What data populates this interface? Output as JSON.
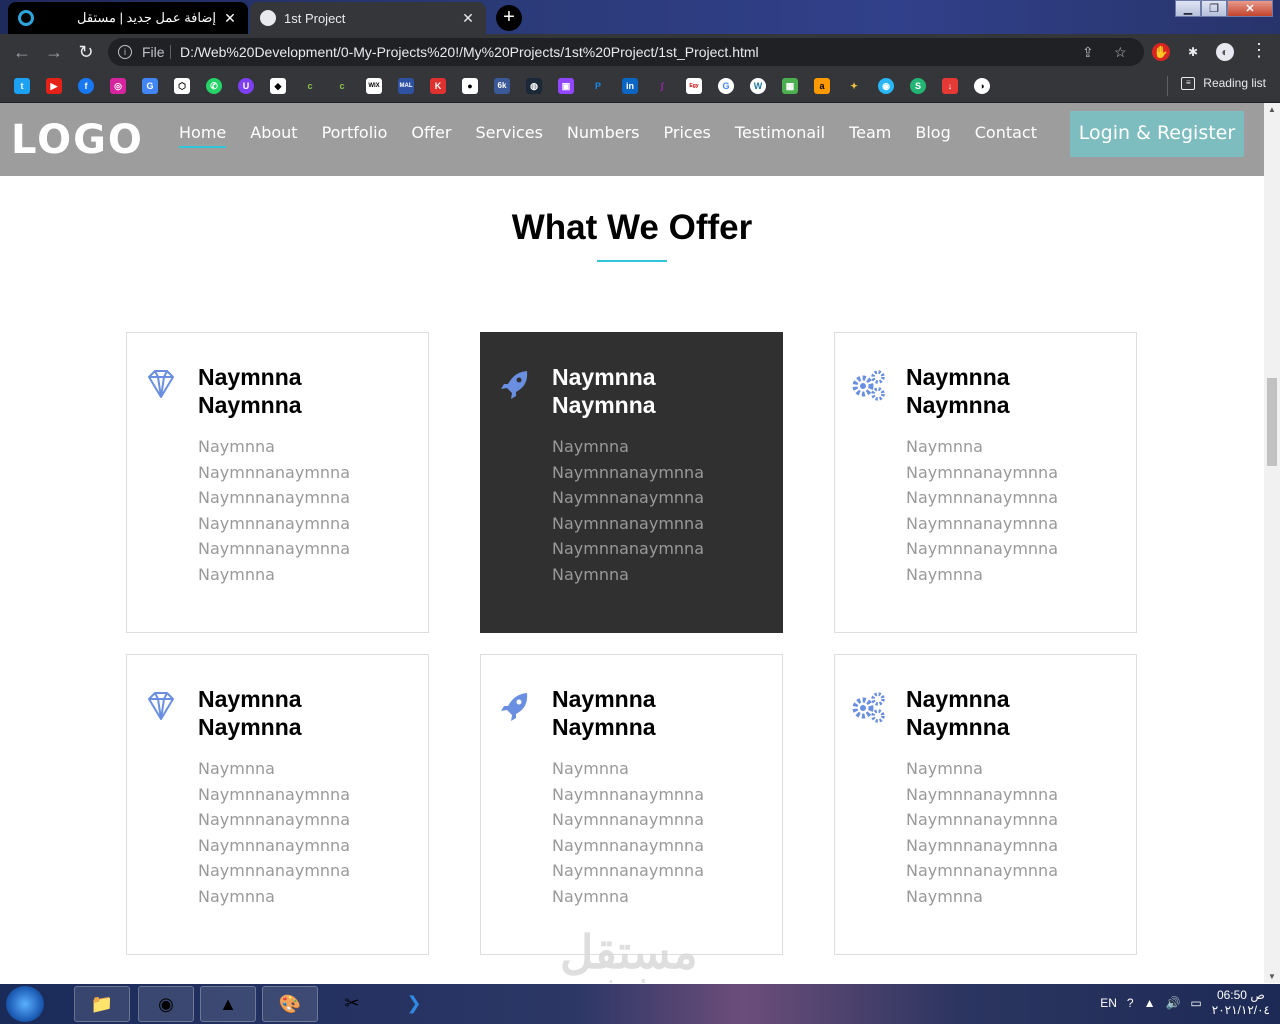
{
  "browser": {
    "tabs": [
      {
        "title": "إضافة عمل جديد | مستقل",
        "active": false
      },
      {
        "title": "1st Project",
        "active": true
      }
    ],
    "new_tab": "+",
    "url_scheme": "File",
    "url": "D:/Web%20Development/0-My-Projects%20!/My%20Projects/1st%20Project/1st_Project.html",
    "reading_list": "Reading list"
  },
  "site": {
    "logo": "LOGO",
    "nav": [
      "Home",
      "About",
      "Portfolio",
      "Offer",
      "Services",
      "Numbers",
      "Prices",
      "Testimonail",
      "Team",
      "Blog",
      "Contact"
    ],
    "active_nav": "Home",
    "login": "Login & Register",
    "section_title": "What We Offer",
    "accent_color": "#2fc7d8",
    "cards": [
      {
        "icon": "diamond-icon",
        "title": "Naymnna Naymnna",
        "desc": "Naymnna\nNaymnnanaymnna\nNaymnnanaymnna\nNaymnnanaymnna\nNaymnnanaymnna\nNaymnna",
        "dark": false
      },
      {
        "icon": "rocket-icon",
        "title": "Naymnna Naymnna",
        "desc": "Naymnna\nNaymnnanaymnna\nNaymnnanaymnna\nNaymnnanaymnna\nNaymnnanaymnna\nNaymnna",
        "dark": true
      },
      {
        "icon": "gears-icon",
        "title": "Naymnna Naymnna",
        "desc": "Naymnna\nNaymnnanaymnna\nNaymnnanaymnna\nNaymnnanaymnna\nNaymnnanaymnna\nNaymnna",
        "dark": false
      },
      {
        "icon": "diamond-icon",
        "title": "Naymnna Naymnna",
        "desc": "Naymnna\nNaymnnanaymnna\nNaymnnanaymnna\nNaymnnanaymnna\nNaymnnanaymnna\nNaymnna",
        "dark": false
      },
      {
        "icon": "rocket-icon",
        "title": "Naymnna Naymnna",
        "desc": "Naymnna\nNaymnnanaymnna\nNaymnnanaymnna\nNaymnnanaymnna\nNaymnnanaymnna\nNaymnna",
        "dark": false
      },
      {
        "icon": "gears-icon",
        "title": "Naymnna Naymnna",
        "desc": "Naymnna\nNaymnnanaymnna\nNaymnnanaymnna\nNaymnnanaymnna\nNaymnnanaymnna\nNaymnna",
        "dark": false
      }
    ],
    "watermark": "مستقل",
    "watermark_sub": "mostaql.com"
  },
  "taskbar": {
    "lang": "EN",
    "time": "06:50 ص",
    "date": "٢٠٢١/١٢/٠٤"
  }
}
